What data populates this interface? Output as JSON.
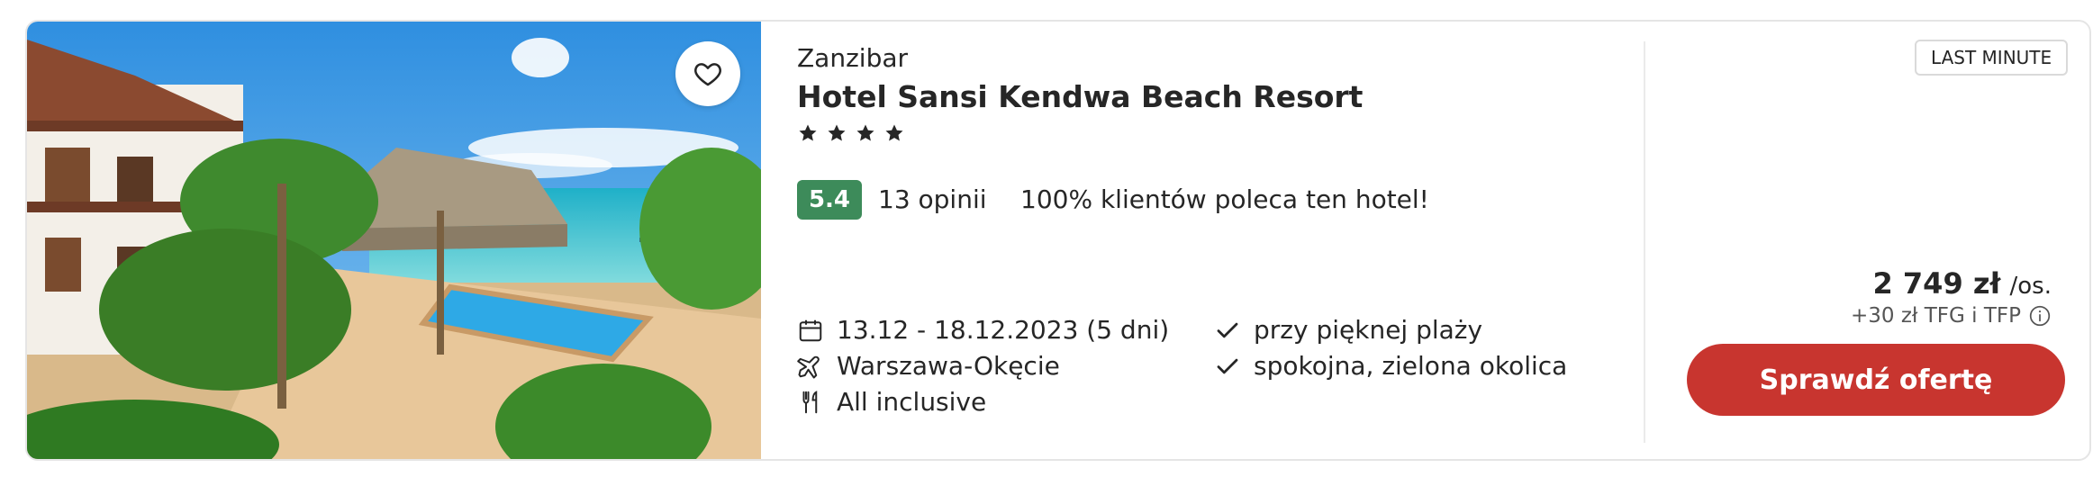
{
  "offer": {
    "region": "Zanzibar",
    "hotel_name": "Hotel Sansi Kendwa Beach Resort",
    "stars": 4,
    "rating": "5.4",
    "reviews": "13 opinii",
    "recommendation": "100% klientów poleca ten hotel!",
    "dates": "13.12 - 18.12.2023 (5 dni)",
    "departure": "Warszawa-Okęcie",
    "board": "All inclusive",
    "features": [
      "przy pięknej plaży",
      "spokojna, zielona okolica"
    ],
    "badge": "LAST MINUTE",
    "price": "2 749 zł",
    "price_unit": "/os.",
    "fees": "+30 zł TFG i TFP",
    "cta": "Sprawdź ofertę"
  },
  "colors": {
    "rating_bg": "#3d8b5a",
    "cta_bg": "#c8352f"
  },
  "icons": [
    "heart-icon",
    "star-icon",
    "calendar-icon",
    "plane-icon",
    "cutlery-icon",
    "check-icon",
    "info-icon"
  ]
}
